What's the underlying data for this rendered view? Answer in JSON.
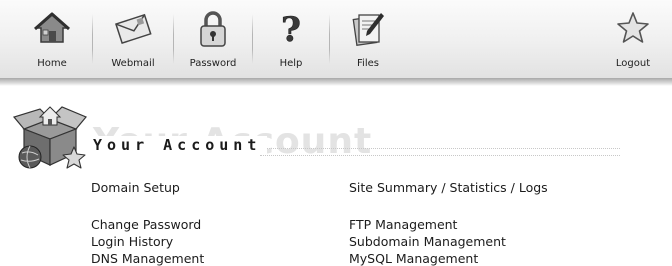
{
  "toolbar": {
    "items": [
      {
        "label": "Home",
        "icon": "home-icon"
      },
      {
        "label": "Webmail",
        "icon": "envelope-icon"
      },
      {
        "label": "Password",
        "icon": "padlock-icon"
      },
      {
        "label": "Help",
        "icon": "question-mark-icon"
      },
      {
        "label": "Files",
        "icon": "files-icon"
      },
      {
        "label": "Logout",
        "icon": "star-icon"
      }
    ]
  },
  "page": {
    "title": "Your Account",
    "ghost_title": "Your Account"
  },
  "links": {
    "left": [
      "Domain Setup",
      "Change Password",
      "Login History",
      "DNS Management"
    ],
    "right": [
      "Site Summary / Statistics / Logs",
      "FTP Management",
      "Subdomain Management",
      "MySQL Management"
    ]
  },
  "colors": {
    "toolbar_top": "#fbfbfb",
    "toolbar_bottom": "#e2e2e2",
    "text": "#1c1c1c",
    "ghost_text": "#e3e3e3"
  }
}
